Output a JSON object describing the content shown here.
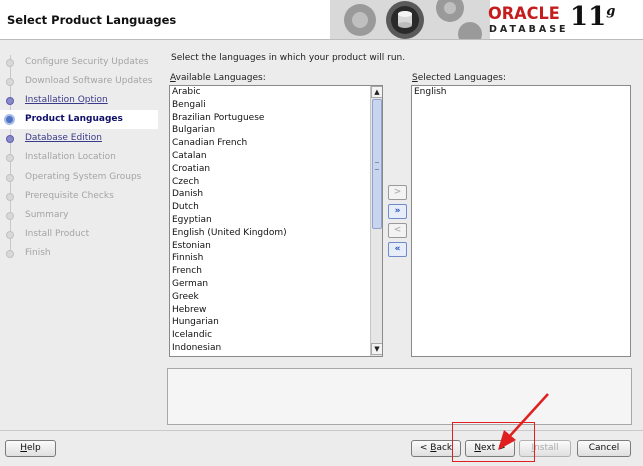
{
  "header": {
    "title": "Select Product Languages",
    "brand_name": "ORACLE",
    "brand_product": "DATABASE",
    "brand_version": "11",
    "brand_version_suffix": "g"
  },
  "sidebar": {
    "steps": [
      {
        "label": "Configure Security Updates",
        "state": "pending"
      },
      {
        "label": "Download Software Updates",
        "state": "pending"
      },
      {
        "label": "Installation Option",
        "state": "done"
      },
      {
        "label": "Product Languages",
        "state": "current"
      },
      {
        "label": "Database Edition",
        "state": "done"
      },
      {
        "label": "Installation Location",
        "state": "pending"
      },
      {
        "label": "Operating System Groups",
        "state": "pending"
      },
      {
        "label": "Prerequisite Checks",
        "state": "pending"
      },
      {
        "label": "Summary",
        "state": "pending"
      },
      {
        "label": "Install Product",
        "state": "pending"
      },
      {
        "label": "Finish",
        "state": "pending"
      }
    ]
  },
  "main": {
    "instruction": "Select the languages in which your product will run.",
    "available_label_prefix": "",
    "available_label_mnemonic": "A",
    "available_label_rest": "vailable Languages:",
    "selected_label_prefix": "",
    "selected_label_mnemonic": "S",
    "selected_label_rest": "elected Languages:",
    "available": [
      "Arabic",
      "Bengali",
      "Brazilian Portuguese",
      "Bulgarian",
      "Canadian French",
      "Catalan",
      "Croatian",
      "Czech",
      "Danish",
      "Dutch",
      "Egyptian",
      "English (United Kingdom)",
      "Estonian",
      "Finnish",
      "French",
      "German",
      "Greek",
      "Hebrew",
      "Hungarian",
      "Icelandic",
      "Indonesian"
    ],
    "selected": [
      "English"
    ],
    "shuttle": {
      "add": ">",
      "add_all": "»",
      "remove": "<",
      "remove_all": "«"
    }
  },
  "footer": {
    "help": {
      "pre": "",
      "key": "H",
      "post": "elp"
    },
    "back": {
      "pre": "< ",
      "key": "B",
      "post": "ack"
    },
    "next": {
      "pre": "",
      "key": "N",
      "post": "ext >"
    },
    "install": {
      "pre": "",
      "key": "I",
      "post": "nstall"
    },
    "cancel": "Cancel"
  }
}
